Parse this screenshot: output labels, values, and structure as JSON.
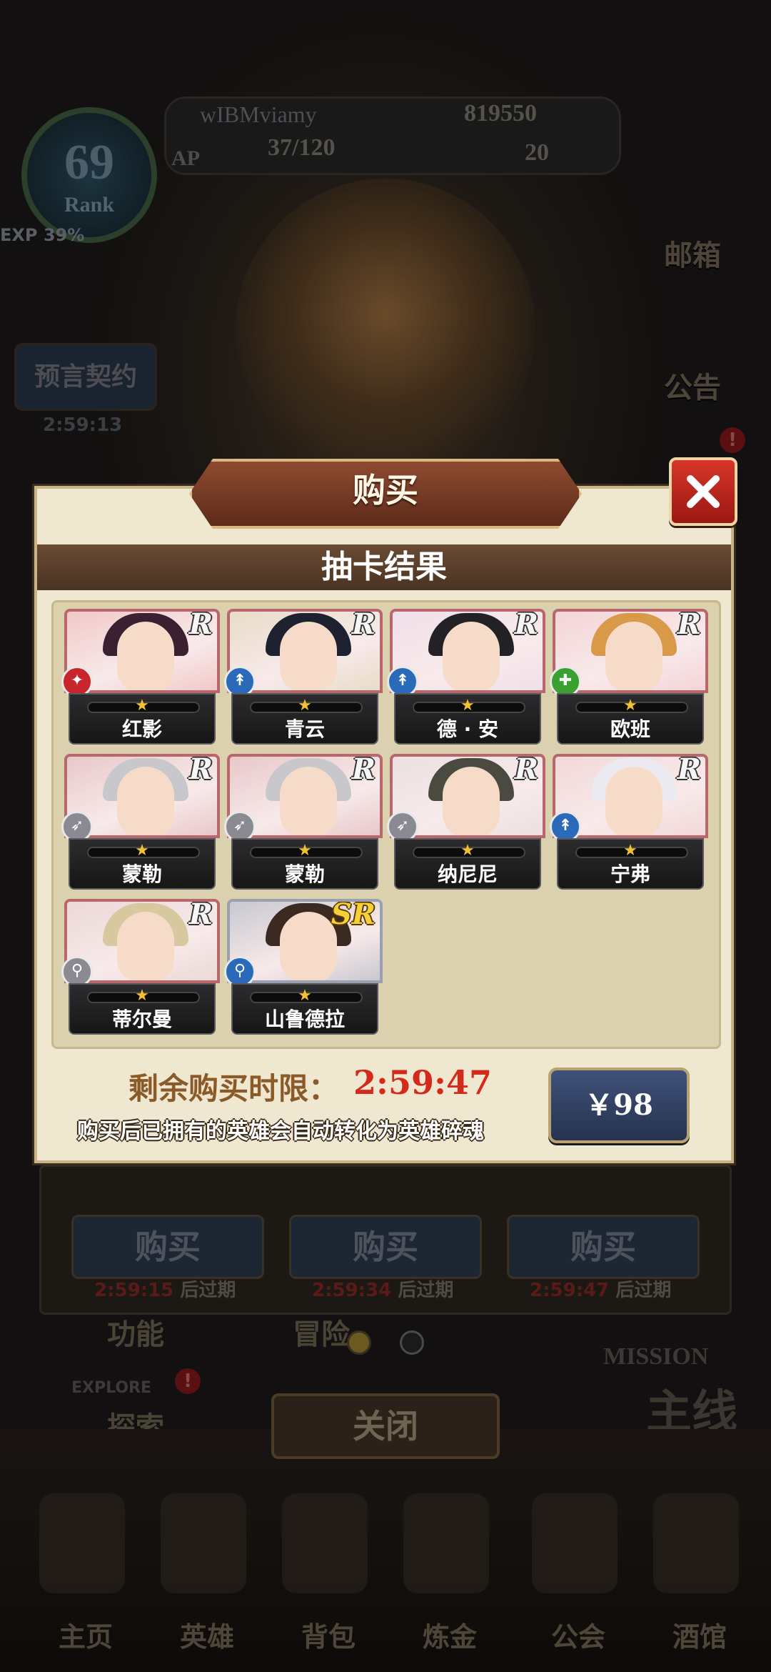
{
  "background": {
    "player_name": "wIBMviamy",
    "gold": "819550",
    "rank_number": "69",
    "rank_label": "Rank",
    "exp_label": "EXP 39%",
    "ap_label": "AP",
    "ap_value": "37/120",
    "gems": "20",
    "mailbox": "邮箱",
    "notice": "公告",
    "contract": "预言契约",
    "contract_timer": "2:59:13",
    "under_buttons": [
      {
        "label": "购买",
        "time": "2:59:15",
        "suffix": "后过期"
      },
      {
        "label": "购买",
        "time": "2:59:34",
        "suffix": "后过期"
      },
      {
        "label": "购买",
        "time": "2:59:47",
        "suffix": "后过期"
      }
    ],
    "left_function": "功能",
    "adventure": "冒险",
    "explore": "探索",
    "explore_tag": "EXPLORE",
    "mission_label": "MISSION",
    "mainline": "主线",
    "close_button": "关闭",
    "nav": [
      "主页",
      "英雄",
      "背包",
      "炼金",
      "公会",
      "酒馆"
    ]
  },
  "dialog": {
    "title": "购买",
    "subtitle": "抽卡结果",
    "timer_label": "剩余购买时限：",
    "timer_value": "2:59:47",
    "note": "购买后已拥有的英雄会自动转化为英雄碎魂",
    "price": "￥98",
    "close_icon": "close-x-icon",
    "cards": [
      {
        "name": "红影",
        "rarity": "R",
        "class_color": "#c8262c",
        "class_glyph": "✦",
        "hair": "#3a2030",
        "bg": "#f2c8c8",
        "stars": 1
      },
      {
        "name": "青云",
        "rarity": "R",
        "class_color": "#2a6ab8",
        "class_glyph": "↟",
        "hair": "#1e2230",
        "bg": "#e8dcc8",
        "stars": 1
      },
      {
        "name": "德 · 安",
        "rarity": "R",
        "class_color": "#2a6ab8",
        "class_glyph": "↟",
        "hair": "#222226",
        "bg": "#f0e0ea",
        "stars": 1
      },
      {
        "name": "欧班",
        "rarity": "R",
        "class_color": "#3aa030",
        "class_glyph": "✚",
        "hair": "#d89a48",
        "bg": "#f4d4d8",
        "stars": 1
      },
      {
        "name": "蒙勒",
        "rarity": "R",
        "class_color": "#8a8a92",
        "class_glyph": "➶",
        "hair": "#c8c8cc",
        "bg": "#e8c8c8",
        "stars": 1
      },
      {
        "name": "蒙勒",
        "rarity": "R",
        "class_color": "#8a8a92",
        "class_glyph": "➶",
        "hair": "#c8c8cc",
        "bg": "#e8c8c8",
        "stars": 1
      },
      {
        "name": "纳尼尼",
        "rarity": "R",
        "class_color": "#8a8a92",
        "class_glyph": "➶",
        "hair": "#4a4a40",
        "bg": "#ece0e0",
        "stars": 1
      },
      {
        "name": "宁弗",
        "rarity": "R",
        "class_color": "#2a6ab8",
        "class_glyph": "↟",
        "hair": "#eaeaf0",
        "bg": "#f2d8d8",
        "stars": 1
      },
      {
        "name": "蒂尔曼",
        "rarity": "R",
        "class_color": "#8a8a92",
        "class_glyph": "⚲",
        "hair": "#d8c8a0",
        "bg": "#ecd8d8",
        "stars": 1
      },
      {
        "name": "山鲁德拉",
        "rarity": "SR",
        "class_color": "#2a6ab8",
        "class_glyph": "⚲",
        "hair": "#3a2a22",
        "bg": "#c8c8d0",
        "stars": 1
      }
    ]
  }
}
